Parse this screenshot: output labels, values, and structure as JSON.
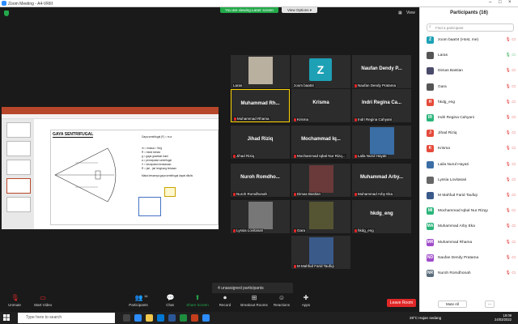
{
  "window": {
    "title": "Zoom Meeting - A4-VRIII"
  },
  "banner": {
    "viewing": "You are viewing Laras' screen",
    "view_options": "View Options ▾"
  },
  "top": {
    "view_label": "View"
  },
  "shared_slide": {
    "title": "GAYA SENTRIFUGAL",
    "lines": [
      "Gaya sentrifugal (F) = m.a",
      "m = massa = W/g",
      "R = berat benda",
      "g = gaya gravitasi bumi",
      "a = percepatan sentrifugal",
      "V = kecepatan kendaraan",
      "R = jari - jari lengkung lintasan",
      "Maka besarnya gaya sentrifugal dapat ditulis"
    ]
  },
  "tiles": [
    {
      "name": "",
      "label": "Laras",
      "muted": false,
      "video": true
    },
    {
      "name": "Z",
      "label": "zoom baa04",
      "muted": false,
      "video": false,
      "avatar": true
    },
    {
      "name": "Naufan Dendy P...",
      "label": "Naufan Dendy Pratama",
      "muted": true
    },
    {
      "name": "Muhammad Rh...",
      "label": "Muhammad Rhama",
      "muted": true,
      "active": true
    },
    {
      "name": "Krisma",
      "label": "Krisma",
      "muted": true
    },
    {
      "name": "Indri Regina Ca...",
      "label": "Indri Regina Cahyani",
      "muted": true
    },
    {
      "name": "Jihad Riziq",
      "label": "Jihad Riziq",
      "muted": true
    },
    {
      "name": "Mochammad Iq...",
      "label": "Mochammad Iqbal Nur Rizq...",
      "muted": true
    },
    {
      "name": "",
      "label": "Laila Nurul Hayati",
      "muted": true,
      "video": true
    },
    {
      "name": "Nuroh Romdho...",
      "label": "Nuroh Romdhonah",
      "muted": true
    },
    {
      "name": "",
      "label": "Dimas Bastian",
      "muted": true,
      "video": true
    },
    {
      "name": "Muhammad Arby...",
      "label": "Muhammad Arby Eka",
      "muted": true
    },
    {
      "name": "",
      "label": "Lyssia Lovitasari",
      "muted": true,
      "video": true
    },
    {
      "name": "",
      "label": "Gara",
      "muted": true,
      "video": true
    },
    {
      "name": "hkdg_eng",
      "label": "hkdg_eng",
      "muted": true
    },
    {
      "name": "",
      "label": "M Mahfud Farid Taufiqi",
      "muted": true,
      "video": true
    }
  ],
  "unassigned": "4 unassigned participants",
  "toolbar": {
    "unmute": "Unmute",
    "video": "Start Video",
    "participants": "Participants",
    "participants_count": "16",
    "chat": "Chat",
    "share": "Share Screen",
    "record": "Record",
    "breakout": "Breakout Rooms",
    "reactions": "Reactions",
    "apps": "Apps",
    "leave": "Leave Room"
  },
  "panel": {
    "title": "Participants (16)",
    "search_placeholder": "Find a participant",
    "participants": [
      {
        "name": "zoom baa04 (Host, me)",
        "initial": "Z",
        "color": "#1ea1b5"
      },
      {
        "name": "Laras",
        "initial": "L",
        "color": "#555",
        "photo": true
      },
      {
        "name": "Dimas Bastian",
        "initial": "D",
        "color": "#4a4a6a",
        "photo": true
      },
      {
        "name": "Gara",
        "initial": "G",
        "color": "#555",
        "photo": true
      },
      {
        "name": "hkdg_eng",
        "initial": "H",
        "color": "#e54b3c"
      },
      {
        "name": "Indri Regina Cahyani",
        "initial": "IR",
        "color": "#2bb57b"
      },
      {
        "name": "Jihad Riziq",
        "initial": "J",
        "color": "#e54b3c"
      },
      {
        "name": "Krisma",
        "initial": "K",
        "color": "#e54b3c"
      },
      {
        "name": "Laila Nurul Hayati",
        "initial": "L",
        "color": "#3a6ea5",
        "photo": true
      },
      {
        "name": "Lyssia Lovitasari",
        "initial": "L",
        "color": "#666",
        "photo": true
      },
      {
        "name": "M Mahfud Farid Taufiqi",
        "initial": "M",
        "color": "#3a5a8a",
        "photo": true
      },
      {
        "name": "Mochammad Iqbal Nur Rizqy",
        "initial": "MI",
        "color": "#2bb57b"
      },
      {
        "name": "Muhammad Arby Eka",
        "initial": "MA",
        "color": "#2bb57b"
      },
      {
        "name": "Muhammad Rhama",
        "initial": "MR",
        "color": "#a04cc9"
      },
      {
        "name": "Naufan Dendy Pratama",
        "initial": "ND",
        "color": "#a04cc9"
      },
      {
        "name": "Nuroh Romdhonah",
        "initial": "NR",
        "color": "#5a6b7a"
      }
    ],
    "mute_all": "Mute All",
    "more": "..."
  },
  "taskbar": {
    "search": "Type here to search",
    "weather": "29°C  Hujan sedang",
    "time": "19:09",
    "date": "24/03/2022"
  }
}
